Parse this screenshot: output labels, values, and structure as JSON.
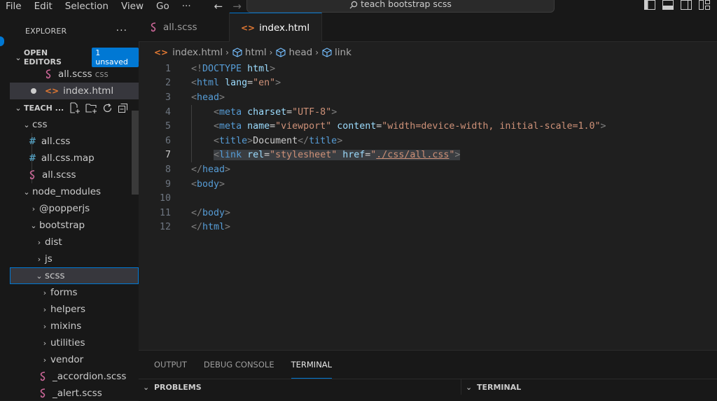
{
  "menu": [
    "File",
    "Edit",
    "Selection",
    "View",
    "Go",
    "···"
  ],
  "command_center": "teach bootstrap scss",
  "sidebar": {
    "title": "EXPLORER",
    "open_editors": {
      "label": "OPEN EDITORS",
      "badge": "1 unsaved",
      "items": [
        {
          "name": "all.scss",
          "ext": "css"
        },
        {
          "name": "index.html"
        }
      ]
    },
    "workspace": "TEACH ...",
    "tree": [
      {
        "label": "css",
        "type": "folder-open"
      },
      {
        "label": "all.css",
        "type": "css"
      },
      {
        "label": "all.css.map",
        "type": "css"
      },
      {
        "label": "all.scss",
        "type": "scss"
      },
      {
        "label": "node_modules",
        "type": "folder-open"
      },
      {
        "label": "@popperjs",
        "type": "folder-closed"
      },
      {
        "label": "bootstrap",
        "type": "folder-open"
      },
      {
        "label": "dist",
        "type": "folder-closed"
      },
      {
        "label": "js",
        "type": "folder-closed"
      },
      {
        "label": "scss",
        "type": "folder-open"
      },
      {
        "label": "forms",
        "type": "folder-closed"
      },
      {
        "label": "helpers",
        "type": "folder-closed"
      },
      {
        "label": "mixins",
        "type": "folder-closed"
      },
      {
        "label": "utilities",
        "type": "folder-closed"
      },
      {
        "label": "vendor",
        "type": "folder-closed"
      },
      {
        "label": "_accordion.scss",
        "type": "scss"
      },
      {
        "label": "_alert.scss",
        "type": "scss"
      }
    ]
  },
  "tabs": [
    {
      "label": "all.scss",
      "icon": "sass-icon"
    },
    {
      "label": "index.html",
      "icon": "html-icon",
      "unsaved": true
    }
  ],
  "breadcrumb": [
    "index.html",
    "html",
    "head",
    "link"
  ],
  "editor": {
    "line_numbers": [
      "1",
      "2",
      "3",
      "4",
      "5",
      "6",
      "7",
      "8",
      "9",
      "10",
      "11",
      "12"
    ],
    "current_line": "7"
  },
  "panel": {
    "tabs": [
      "OUTPUT",
      "DEBUG CONSOLE",
      "TERMINAL"
    ],
    "active_tab": "TERMINAL",
    "sections": [
      "PROBLEMS",
      "TERMINAL"
    ]
  },
  "colors": {
    "accent": "#0078d4",
    "tag": "#569cd6",
    "attribute": "#9cdcfe",
    "string": "#ce9178",
    "sass": "#cd6799",
    "html_icon": "#e37933"
  }
}
